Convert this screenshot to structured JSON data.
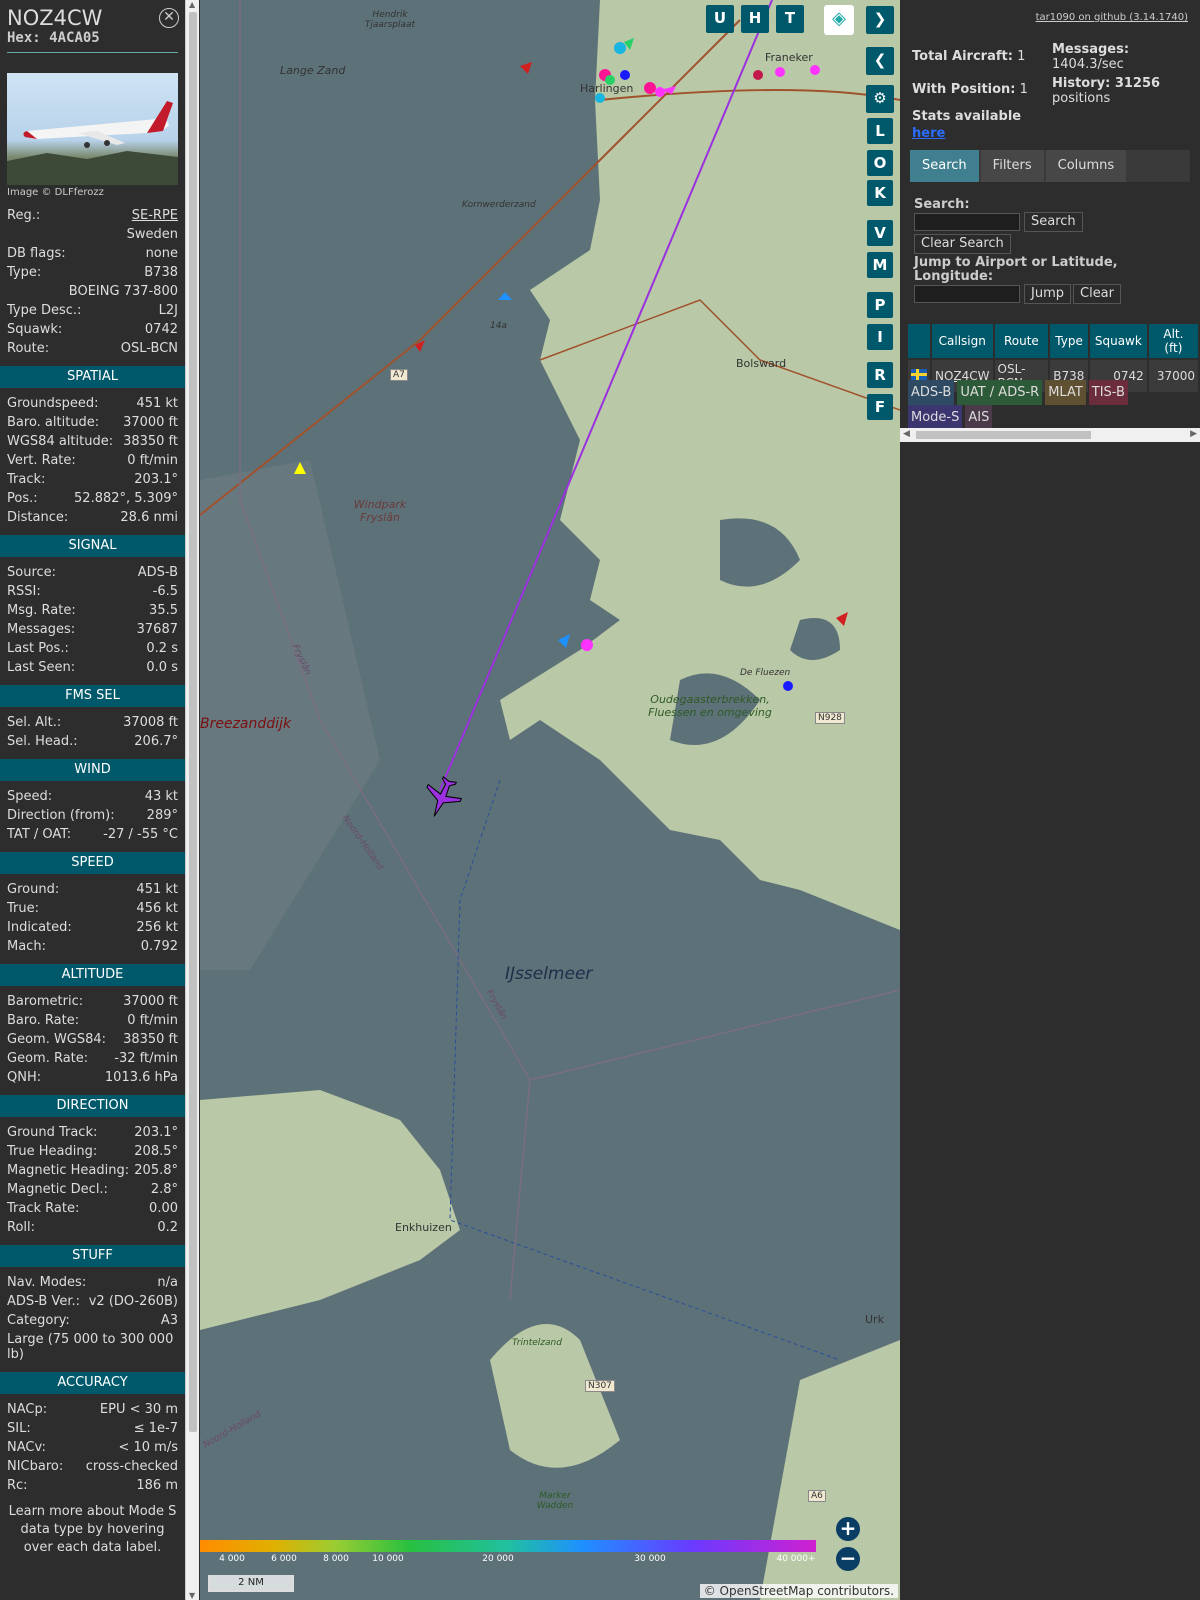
{
  "sidebar": {
    "callsign": "NOZ4CW",
    "hex_label": "Hex:",
    "hex": "4ACA05",
    "photo_credit": "Image © DLFferozz",
    "info": [
      {
        "label": "Reg.:",
        "value": "SE-RPE"
      },
      {
        "label": "",
        "value": "Sweden"
      },
      {
        "label": "DB flags:",
        "value": "none"
      },
      {
        "label": "Type:",
        "value": "B738"
      },
      {
        "label": "",
        "value": "BOEING 737-800"
      },
      {
        "label": "Type Desc.:",
        "value": "L2J"
      },
      {
        "label": "Squawk:",
        "value": "0742"
      },
      {
        "label": "Route:",
        "value": "OSL-BCN"
      }
    ],
    "sections": [
      {
        "title": "SPATIAL",
        "rows": [
          {
            "label": "Groundspeed:",
            "value": "451 kt"
          },
          {
            "label": "Baro. altitude:",
            "value": "37000 ft"
          },
          {
            "label": "WGS84 altitude:",
            "value": "38350 ft"
          },
          {
            "label": "Vert. Rate:",
            "value": "0 ft/min"
          },
          {
            "label": "Track:",
            "value": "203.1°"
          },
          {
            "label": "Pos.:",
            "value": "52.882°, 5.309°"
          },
          {
            "label": "Distance:",
            "value": "28.6 nmi"
          }
        ]
      },
      {
        "title": "SIGNAL",
        "rows": [
          {
            "label": "Source:",
            "value": "ADS-B"
          },
          {
            "label": "RSSI:",
            "value": "-6.5"
          },
          {
            "label": "Msg. Rate:",
            "value": "35.5"
          },
          {
            "label": "Messages:",
            "value": "37687"
          },
          {
            "label": "Last Pos.:",
            "value": "0.2 s"
          },
          {
            "label": "Last Seen:",
            "value": "0.0 s"
          }
        ]
      },
      {
        "title": "FMS SEL",
        "rows": [
          {
            "label": "Sel. Alt.:",
            "value": "37008 ft"
          },
          {
            "label": "Sel. Head.:",
            "value": "206.7°"
          }
        ]
      },
      {
        "title": "WIND",
        "rows": [
          {
            "label": "Speed:",
            "value": "43 kt"
          },
          {
            "label": "Direction (from):",
            "value": "289°"
          },
          {
            "label": "TAT / OAT:",
            "value": "-27 / -55 °C"
          }
        ]
      },
      {
        "title": "SPEED",
        "rows": [
          {
            "label": "Ground:",
            "value": "451 kt"
          },
          {
            "label": "True:",
            "value": "456 kt"
          },
          {
            "label": "Indicated:",
            "value": "256 kt"
          },
          {
            "label": "Mach:",
            "value": "0.792"
          }
        ]
      },
      {
        "title": "ALTITUDE",
        "rows": [
          {
            "label": "Barometric:",
            "value": "37000 ft"
          },
          {
            "label": "Baro. Rate:",
            "value": "0 ft/min"
          },
          {
            "label": "Geom. WGS84:",
            "value": "38350 ft"
          },
          {
            "label": "Geom. Rate:",
            "value": "-32 ft/min"
          },
          {
            "label": "QNH:",
            "value": "1013.6 hPa"
          }
        ]
      },
      {
        "title": "DIRECTION",
        "rows": [
          {
            "label": "Ground Track:",
            "value": "203.1°"
          },
          {
            "label": "True Heading:",
            "value": "208.5°"
          },
          {
            "label": "Magnetic Heading:",
            "value": "205.8°"
          },
          {
            "label": "Magnetic Decl.:",
            "value": "2.8°"
          },
          {
            "label": "Track Rate:",
            "value": "0.00"
          },
          {
            "label": "Roll:",
            "value": "0.2"
          }
        ]
      },
      {
        "title": "STUFF",
        "rows": [
          {
            "label": "Nav. Modes:",
            "value": "n/a"
          },
          {
            "label": "ADS-B Ver.:",
            "value": "v2 (DO-260B)"
          },
          {
            "label": "Category:",
            "value": "A3"
          },
          {
            "label": "Large (75 000 to 300 000 lb)",
            "value": ""
          }
        ]
      },
      {
        "title": "ACCURACY",
        "rows": [
          {
            "label": "NACp:",
            "value": "EPU < 30 m"
          },
          {
            "label": "SIL:",
            "value": "≤ 1e-7"
          },
          {
            "label": "NACv:",
            "value": "< 10 m/s"
          },
          {
            "label": "NICbaro:",
            "value": "cross-checked"
          },
          {
            "label": "Rc:",
            "value": "186 m"
          }
        ]
      }
    ],
    "footer": "Learn more about Mode S data type by hovering over each data label."
  },
  "map": {
    "buttons_top": [
      "U",
      "H",
      "T"
    ],
    "buttons_side": [
      "L",
      "O",
      "K",
      "V",
      "M",
      "P",
      "I",
      "R",
      "F"
    ],
    "labels": {
      "lange_zand": "Lange Zand",
      "kornwerderzand": "Kornwerderzand",
      "windpark": "Windpark Fryslân",
      "breezanddijk": "Breezanddijk",
      "ijsselmeer": "IJsselmeer",
      "bolsward": "Bolsward",
      "franeker": "Franeker",
      "harlingen": "Harlingen",
      "oudega": "Oudegaasterbrekken, Fluessen en omgeving",
      "de_fluezen": "De Fluezen",
      "enkhuizen": "Enkhuizen",
      "trintelzand": "Trintelzand",
      "marker_wadden": "Marker Wadden",
      "urk": "Urk",
      "noord_holland": "Noord-Holland",
      "fryslan": "Fryslân",
      "hendrik": "Hendrik Tjaarsplaat",
      "n928": "N928",
      "n307": "N307",
      "a7": "A7",
      "a6": "A6",
      "r14a": "14a"
    },
    "colorbar_ticks": [
      "4 000",
      "6 000",
      "8 000",
      "10 000",
      "20 000",
      "30 000",
      "40 000+"
    ],
    "scale": "2 NM",
    "attribution": "© OpenStreetMap contributors."
  },
  "right": {
    "github": "tar1090 on github (3.14.1740)",
    "total_aircraft_label": "Total Aircraft:",
    "total_aircraft": "1",
    "with_position_label": "With Position:",
    "with_position": "1",
    "stats_label": "Stats available",
    "stats_link": "here",
    "messages_label": "Messages:",
    "messages_value": "1404.3/sec",
    "history_label": "History: 31256",
    "history_value": "positions",
    "tabs": [
      "Search",
      "Filters",
      "Columns"
    ],
    "search_label": "Search:",
    "search_btn": "Search",
    "clear_search_btn": "Clear Search",
    "jump_label": "Jump to Airport or Latitude, Longitude:",
    "jump_btn": "Jump",
    "clear_btn": "Clear",
    "table_headers": [
      "",
      "Callsign",
      "Route",
      "Type",
      "Squawk",
      "Alt. (ft)"
    ],
    "table_row": {
      "callsign": "NOZ4CW",
      "route": "OSL-BCN",
      "type": "B738",
      "squawk": "0742",
      "alt": "37000"
    },
    "badges": [
      {
        "label": "ADS-B",
        "color": "#2e4b63"
      },
      {
        "label": "UAT / ADS-R",
        "color": "#2d5a38"
      },
      {
        "label": "MLAT",
        "color": "#5e5030"
      },
      {
        "label": "TIS-B",
        "color": "#6b2d3c"
      },
      {
        "label": "Mode-S",
        "color": "#3b3670"
      },
      {
        "label": "AIS",
        "color": "#4a3a4a"
      }
    ]
  }
}
